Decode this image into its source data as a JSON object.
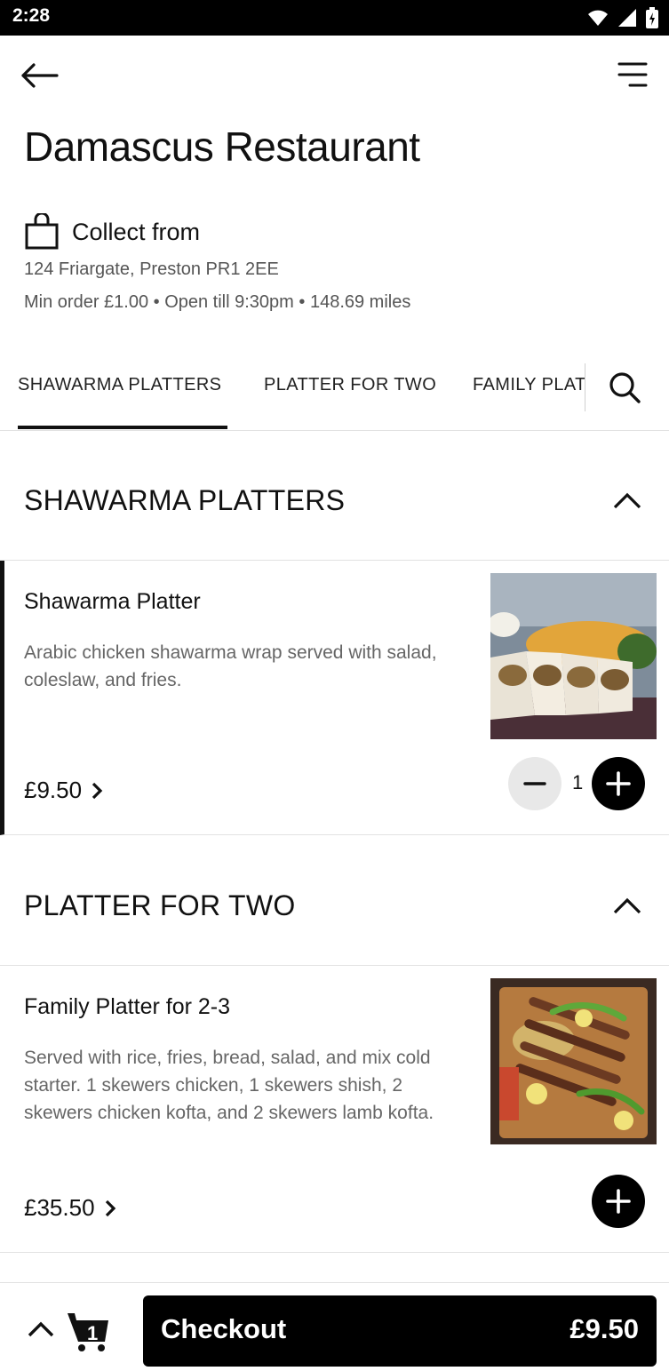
{
  "status_bar": {
    "time": "2:28"
  },
  "restaurant": {
    "name": "Damascus Restaurant",
    "collect_label": "Collect from",
    "address": "124 Friargate, Preston PR1 2EE",
    "meta": "Min order £1.00 • Open till 9:30pm • 148.69  miles"
  },
  "tabs": [
    {
      "label": "SHAWARMA PLATTERS",
      "active": true
    },
    {
      "label": "PLATTER FOR TWO",
      "active": false
    },
    {
      "label": "FAMILY PLATTERS",
      "active": false
    }
  ],
  "sections": [
    {
      "title": "SHAWARMA PLATTERS",
      "items": [
        {
          "name": "Shawarma Platter",
          "description": "Arabic chicken shawarma wrap served with salad, coleslaw, and fries.",
          "price": "£9.50",
          "quantity": "1"
        }
      ]
    },
    {
      "title": "PLATTER FOR TWO",
      "items": [
        {
          "name": "Family Platter for 2-3",
          "description": "Served with rice, fries, bread, salad, and mix cold starter. 1 skewers chicken, 1 skewers shish, 2 skewers chicken kofta, and 2 skewers lamb kofta.",
          "price": "£35.50"
        }
      ]
    }
  ],
  "cart": {
    "count": "1",
    "checkout_label": "Checkout",
    "total": "£9.50"
  },
  "colors": {
    "primary": "#000000",
    "muted_text": "#666666",
    "divider": "#e2e2e2"
  }
}
